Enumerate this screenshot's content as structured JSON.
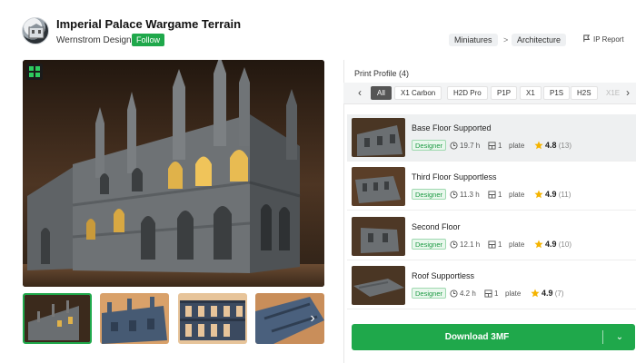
{
  "header": {
    "title": "Imperial Palace Wargame Terrain",
    "author": "Wernstrom Designs",
    "follow_label": "Follow",
    "breadcrumbs": [
      "Miniatures",
      "Architecture"
    ],
    "breadcrumb_sep": ">",
    "report_label": "IP Report"
  },
  "gallery": {
    "next_glyph": "›",
    "thumbnail_count": 4
  },
  "panel": {
    "title": "Print Profile (4)",
    "prev_glyph": "‹",
    "next_glyph": "›",
    "tabs": [
      "All",
      "X1 Carbon",
      "H2D Pro",
      "P1P",
      "X1",
      "P1S",
      "H2S",
      "X1E"
    ],
    "active_tab": "All",
    "profiles": [
      {
        "name": "Base Floor Supported",
        "badge": "Designer",
        "time": "19.7 h",
        "plates": "1",
        "plate_label": "plate",
        "rating": "4.8",
        "count": "(13)"
      },
      {
        "name": "Third Floor Supportless",
        "badge": "Designer",
        "time": "11.3 h",
        "plates": "1",
        "plate_label": "plate",
        "rating": "4.9",
        "count": "(11)"
      },
      {
        "name": "Second Floor",
        "badge": "Designer",
        "time": "12.1 h",
        "plates": "1",
        "plate_label": "plate",
        "rating": "4.9",
        "count": "(10)"
      },
      {
        "name": "Roof Supportless",
        "badge": "Designer",
        "time": "4.2 h",
        "plates": "1",
        "plate_label": "plate",
        "rating": "4.9",
        "count": "(7)"
      }
    ],
    "download_label": "Download 3MF",
    "download_caret": "⌄"
  },
  "colors": {
    "accent": "#1fa84b",
    "star": "#f5b400"
  }
}
